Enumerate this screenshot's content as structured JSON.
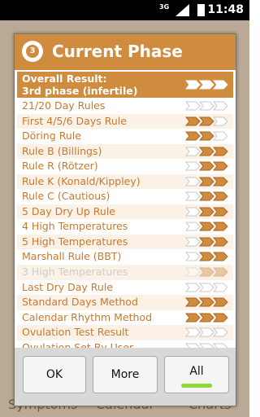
{
  "statusbar": {
    "network": "3G",
    "time": "11:48"
  },
  "background_tabs": [
    "Symptoms",
    "Calendar",
    "Charts"
  ],
  "dialog": {
    "logo_text": "3",
    "title": "Current Phase",
    "overall": {
      "line1": "Overall Result:",
      "line2": "3rd phase (infertile)",
      "arrows": [
        "filled",
        "filled",
        "filled"
      ]
    },
    "rows": [
      {
        "label": "21/20 Day Rules",
        "arrows": [
          "empty",
          "empty",
          "empty"
        ],
        "disabled": false
      },
      {
        "label": "First 4/5/6 Days Rule",
        "arrows": [
          "filled",
          "filled",
          "empty"
        ],
        "disabled": false
      },
      {
        "label": "Döring Rule",
        "arrows": [
          "filled",
          "filled",
          "empty"
        ],
        "disabled": false
      },
      {
        "label": "Rule B (Billings)",
        "arrows": [
          "empty",
          "filled",
          "filled"
        ],
        "disabled": false
      },
      {
        "label": "Rule R (Rötzer)",
        "arrows": [
          "empty",
          "filled",
          "filled"
        ],
        "disabled": false
      },
      {
        "label": "Rule K (Konald/Kippley)",
        "arrows": [
          "empty",
          "filled",
          "filled"
        ],
        "disabled": false
      },
      {
        "label": "Rule C (Cautious)",
        "arrows": [
          "empty",
          "filled",
          "filled"
        ],
        "disabled": false
      },
      {
        "label": "5 Day Dry Up Rule",
        "arrows": [
          "empty",
          "filled",
          "filled"
        ],
        "disabled": false
      },
      {
        "label": "4 High Temperatures",
        "arrows": [
          "empty",
          "filled",
          "filled"
        ],
        "disabled": false
      },
      {
        "label": "5 High Temperatures",
        "arrows": [
          "empty",
          "filled",
          "filled"
        ],
        "disabled": false
      },
      {
        "label": "Marshall Rule (BBT)",
        "arrows": [
          "empty",
          "filled",
          "filled"
        ],
        "disabled": false
      },
      {
        "label": "3 High Temperatures",
        "arrows": [
          "empty",
          "filled",
          "filled"
        ],
        "disabled": true
      },
      {
        "label": "Last Dry Day Rule",
        "arrows": [
          "empty",
          "empty",
          "empty"
        ],
        "disabled": false
      },
      {
        "label": "Standard Days Method",
        "arrows": [
          "filled",
          "filled",
          "filled"
        ],
        "disabled": false
      },
      {
        "label": "Calendar Rhythm Method",
        "arrows": [
          "filled",
          "filled",
          "filled"
        ],
        "disabled": false
      },
      {
        "label": "Ovulation Test Result",
        "arrows": [
          "empty",
          "empty",
          "empty"
        ],
        "disabled": false
      },
      {
        "label": "Ovulation Set By User",
        "arrows": [
          "empty",
          "empty",
          "empty"
        ],
        "disabled": false
      }
    ],
    "buttons": {
      "ok": "OK",
      "more": "More",
      "all": "All"
    }
  },
  "colors": {
    "accent": "#cf8b3e",
    "label": "#c77a2d",
    "disabled": "#cccccc",
    "indicator": "#8ed833"
  }
}
